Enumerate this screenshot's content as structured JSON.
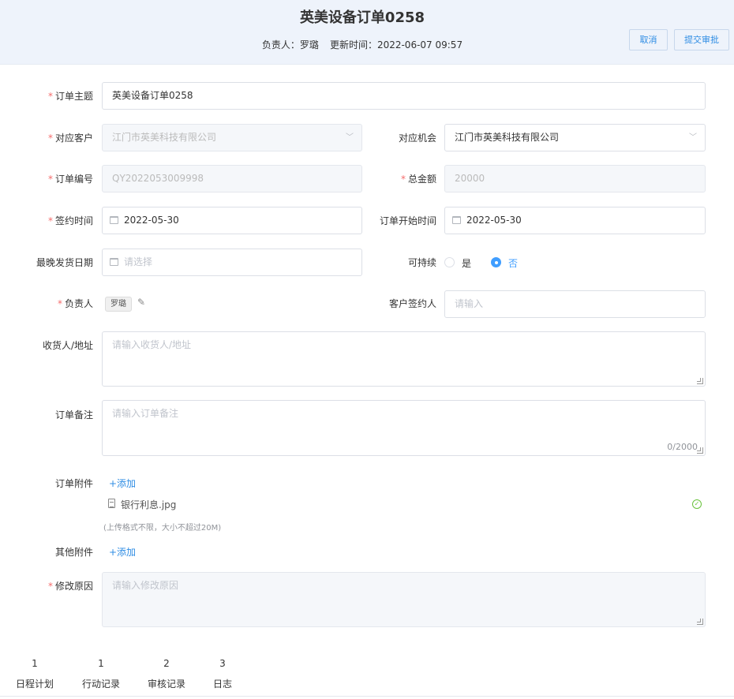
{
  "header": {
    "title": "英美设备订单0258",
    "owner_label": "负责人：罗璐",
    "updated_label": "更新时间：2022-06-07 09:57",
    "cancel_label": "取消",
    "submit_label": "提交审批"
  },
  "form": {
    "required_mark": "*",
    "subject": {
      "label": "订单主题",
      "value": "英美设备订单0258"
    },
    "customer": {
      "label": "对应客户",
      "value": "江门市英美科技有限公司"
    },
    "opportunity": {
      "label": "对应机会",
      "value": "江门市英美科技有限公司"
    },
    "order_no": {
      "label": "订单编号",
      "value": "QY2022053009998"
    },
    "total": {
      "label": "总金额",
      "value": "20000"
    },
    "sign_date": {
      "label": "签约时间",
      "value": "2022-05-30"
    },
    "start_date": {
      "label": "订单开始时间",
      "value": "2022-05-30"
    },
    "latest_ship": {
      "label": "最晚发货日期",
      "placeholder": "请选择"
    },
    "sustainable": {
      "label": "可持续",
      "options": [
        "是",
        "否"
      ],
      "selected": "否"
    },
    "owner": {
      "label": "负责人",
      "tag": "罗璐"
    },
    "customer_signer": {
      "label": "客户签约人",
      "placeholder": "请输入"
    },
    "consignee": {
      "label": "收货人/地址",
      "placeholder": "请输入收货人/地址"
    },
    "remark": {
      "label": "订单备注",
      "placeholder": "请输入订单备注",
      "counter": "0/2000"
    },
    "attachment": {
      "label": "订单附件",
      "add_label": "+添加",
      "file_name": "银行利息.jpg",
      "hint": "(上传格式不限，大小不超过20M)"
    },
    "other_attachment": {
      "label": "其他附件",
      "add_label": "+添加"
    },
    "reason": {
      "label": "修改原因",
      "placeholder": "请输入修改原因"
    }
  },
  "tabs": [
    {
      "count": "1",
      "label": "日程计划"
    },
    {
      "count": "1",
      "label": "行动记录"
    },
    {
      "count": "2",
      "label": "审核记录"
    },
    {
      "count": "3",
      "label": "日志"
    }
  ],
  "icons": {
    "dropdown": "chevron-down-icon",
    "date": "calendar-icon",
    "edit": "pencil-icon",
    "file": "file-icon",
    "success": "check-circle-icon"
  },
  "colors": {
    "accent": "#409eff",
    "required": "#f56c6c",
    "success": "#67c23a",
    "header_bg": "#eef3fb"
  }
}
